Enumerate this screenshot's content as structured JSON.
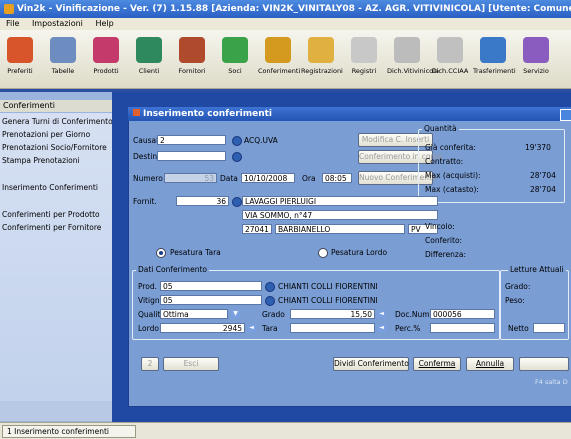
{
  "window": {
    "title": "Vin2k - Vinificazione - Ver. (7) 1.15.88 [Azienda: VIN2K_VINITALY08 - AZ. AGR. VITIVINICOLA] [Utente: Comune] [D"
  },
  "menu": [
    "File",
    "Impostazioni",
    "Help"
  ],
  "toolbar": [
    {
      "label": "Preferiti",
      "icon": "favorites-icon",
      "color": "#d8542a"
    },
    {
      "label": "Tabelle",
      "icon": "tables-icon",
      "color": "#6d8cc0"
    },
    {
      "label": "Prodotti",
      "icon": "products-icon",
      "color": "#c43a6a"
    },
    {
      "label": "Clienti",
      "icon": "clients-icon",
      "color": "#2e8a5e"
    },
    {
      "label": "Fornitori",
      "icon": "suppliers-icon",
      "color": "#b04a2c"
    },
    {
      "label": "Soci",
      "icon": "members-icon",
      "color": "#3aa34a"
    },
    {
      "label": "Conferimenti",
      "icon": "deliveries-icon",
      "color": "#d49a20"
    },
    {
      "label": "Registrazioni",
      "icon": "registrations-icon",
      "color": "#e0b040"
    },
    {
      "label": "Registri",
      "icon": "registers-icon",
      "color": "#c8c8c8"
    },
    {
      "label": "Dich.Vitivinicola",
      "icon": "declaration-icon",
      "color": "#bcbcbc"
    },
    {
      "label": "Dich.CCIAA",
      "icon": "cciaa-icon",
      "color": "#c0c0c0"
    },
    {
      "label": "Trasferimenti",
      "icon": "transfers-icon",
      "color": "#3a78c8"
    },
    {
      "label": "Servizio",
      "icon": "service-icon",
      "color": "#8a5cc0"
    }
  ],
  "left_panel": {
    "header": "Conferimenti",
    "items": [
      "Genera Turni di Conferimento",
      "Prenotazioni per Giorno",
      "Prenotazioni Socio/Fornitore",
      "Stampa Prenotazioni",
      "Inserimento Conferimenti",
      "Conferimenti per Prodotto",
      "Conferimenti per Fornitore"
    ]
  },
  "dialog": {
    "title": "Inserimento conferimenti",
    "causale_label": "Causale",
    "causale_value": "2",
    "causale_desc": "ACQ.UVA",
    "destinaz_label": "Destinaz.",
    "destinaz_value": "",
    "numero_label": "Numero",
    "numero_value": "53",
    "data_label": "Data",
    "data_value": "10/10/2008",
    "ora_label": "Ora",
    "ora_value": "08:05",
    "btn_modifica": "Modifica C. Inserti",
    "btn_conferimento_corso": "Conferimento in corso",
    "btn_nuovo": "Nuovo Conferimento",
    "fornit_label": "Fornit.",
    "fornit_value": "36",
    "fornit_name": "LAVAGGI PIERLUIGI",
    "fornit_address": "VIA SOMMO, n°47",
    "fornit_cap": "27041",
    "fornit_city": "BARBIANELLO",
    "fornit_prov": "PV",
    "quantita": {
      "title": "Quantità",
      "rows": [
        {
          "label": "Già conferita:",
          "value": "19'370"
        },
        {
          "label": "Contratto:",
          "value": ""
        },
        {
          "label": "Max (acquisti):",
          "value": "28'704"
        },
        {
          "label": "Max (catasto):",
          "value": "28'704"
        }
      ]
    },
    "vincolo_rows": [
      "Vincolo:",
      "Conferito:",
      "Differenza:"
    ],
    "pesatura_tara": "Pesatura Tara",
    "pesatura_lordo": "Pesatura Lordo",
    "dati": {
      "title": "Dati Conferimento",
      "prod_label": "Prod.",
      "prod_value": "05",
      "prod_desc": "CHIANTI COLLI FIORENTINI",
      "vitigno_label": "Vitigno",
      "vitigno_value": "05",
      "vitigno_desc": "CHIANTI COLLI FIORENTINI",
      "qualita_label": "Qualità",
      "qualita_value": "Ottima",
      "grado_label": "Grado",
      "grado_value": "15,50",
      "docnum_label": "Doc.Num.",
      "docnum_value": "000056",
      "lordo_label": "Lordo",
      "lordo_value": "2945",
      "tara_label": "Tara",
      "tara_value": "",
      "perc_label": "Perc.%",
      "perc_value": ""
    },
    "letture": {
      "title": "Letture Attuali",
      "grado_label": "Grado:",
      "peso_label": "Peso:",
      "netto_label": "Netto"
    },
    "btn_2": "2",
    "btn_esci": "Esci",
    "btn_dividi": "Dividi Conferimento",
    "btn_conferma": "Conferma",
    "btn_annulla": "Annulla",
    "footer_text": "F4 salta D"
  },
  "taskbar": {
    "item": "1 Inserimento conferimenti"
  }
}
